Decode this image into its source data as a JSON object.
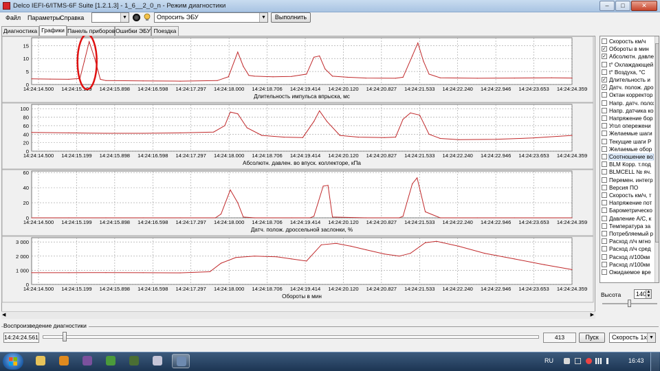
{
  "window": {
    "title": "Delco IEFI-6/ITMS-6F Suite [1.2.1.3] - 1_6__2_0_n - Режим диагностики",
    "minimize_glyph": "–",
    "maximize_glyph": "□",
    "close_glyph": "✕"
  },
  "menu": [
    "Файл",
    "Параметры",
    "Справка"
  ],
  "toolbar": {
    "port_value": "",
    "query_label": "Опросить ЭБУ",
    "execute_label": "Выполнить"
  },
  "tabs": [
    "Диагностика",
    "Графики",
    "Панель приборов",
    "Ошибки ЭБУ",
    "Поездка"
  ],
  "active_tab": "Графики",
  "colors": {
    "trace": "#c0282a",
    "grid": "#9a9a9a",
    "annotation": "#e01010"
  },
  "chart_data": [
    {
      "type": "line",
      "xlabel": "Длительность импульса впрыска, мс",
      "x_ticks": [
        "14:24:14.500",
        "14:24:15.199",
        "14:24:15.898",
        "14:24:16.598",
        "14:24:17.297",
        "14:24:18.000",
        "14:24:18.706",
        "14:24:19.414",
        "14:24:20.120",
        "14:24:20.827",
        "14:24:21.533",
        "14:24:22.240",
        "14:24:22.946",
        "14:24:23.653",
        "14:24:24.359"
      ],
      "y_ticks": [
        "0",
        "5",
        "10",
        "15"
      ],
      "ylim": [
        0,
        18
      ],
      "x": [
        0,
        0.5,
        1.0,
        1.3,
        1.42,
        1.55,
        1.7,
        1.85,
        2.0,
        3.0,
        4.0,
        5.0,
        5.3,
        5.55,
        5.7,
        5.85,
        6.0,
        6.5,
        7.0,
        7.4,
        7.6,
        7.75,
        7.9,
        8.1,
        8.5,
        9.0,
        9.8,
        10.0,
        10.25,
        10.4,
        10.55,
        10.7,
        11.0,
        12.0,
        13.0,
        14.0,
        14.55
      ],
      "values": [
        2.2,
        2.1,
        2.0,
        2.3,
        9.0,
        16.5,
        10.0,
        2.0,
        1.5,
        1.4,
        1.3,
        1.5,
        3.0,
        12.5,
        7.0,
        3.5,
        3.2,
        3.0,
        3.1,
        4.0,
        10.5,
        11.0,
        6.0,
        3.2,
        2.8,
        2.5,
        2.4,
        2.8,
        11.0,
        16.0,
        9.0,
        4.0,
        2.6,
        2.4,
        2.5,
        2.6,
        2.5
      ],
      "annotation": {
        "type": "circle",
        "around_x": 1.55
      }
    },
    {
      "type": "line",
      "xlabel": "Абсолютн. давлен. во впуск. коллекторе, кПа",
      "x_ticks": [
        "14:24:14.500",
        "14:24:15.199",
        "14:24:15.898",
        "14:24:16.598",
        "14:24:17.297",
        "14:24:18.000",
        "14:24:18.706",
        "14:24:19.414",
        "14:24:20.120",
        "14:24:20.827",
        "14:24:21.533",
        "14:24:22.240",
        "14:24:22.946",
        "14:24:23.653",
        "14:24:24.359"
      ],
      "y_ticks": [
        "0",
        "20",
        "40",
        "60",
        "80",
        "100"
      ],
      "ylim": [
        0,
        110
      ],
      "x": [
        0,
        1.0,
        2.0,
        3.0,
        4.0,
        4.9,
        5.2,
        5.35,
        5.55,
        5.8,
        6.2,
        6.8,
        7.3,
        7.6,
        7.75,
        7.95,
        8.3,
        8.8,
        9.5,
        9.8,
        10.0,
        10.2,
        10.45,
        10.7,
        11.0,
        11.5,
        12.5,
        13.5,
        14.55
      ],
      "values": [
        44,
        43,
        42,
        42,
        43,
        45,
        60,
        92,
        88,
        55,
        37,
        33,
        32,
        70,
        95,
        70,
        37,
        33,
        32,
        33,
        75,
        90,
        85,
        40,
        30,
        27,
        28,
        31,
        37
      ]
    },
    {
      "type": "line",
      "xlabel": "Датч. полож. дроссельной заслонки, %",
      "x_ticks": [
        "14:24:14.500",
        "14:24:15.199",
        "14:24:15.898",
        "14:24:16.598",
        "14:24:17.297",
        "14:24:18.000",
        "14:24:18.706",
        "14:24:19.414",
        "14:24:20.120",
        "14:24:20.827",
        "14:24:21.533",
        "14:24:22.240",
        "14:24:22.946",
        "14:24:23.653",
        "14:24:24.359"
      ],
      "y_ticks": [
        "0",
        "20",
        "40",
        "60"
      ],
      "ylim": [
        0,
        62
      ],
      "x": [
        0,
        1,
        2,
        3,
        4,
        4.95,
        5.1,
        5.35,
        5.55,
        5.7,
        6,
        7,
        7.5,
        7.6,
        7.85,
        7.98,
        8.1,
        9,
        9.9,
        10.0,
        10.25,
        10.38,
        10.6,
        11,
        12,
        13,
        14.55
      ],
      "values": [
        0,
        0,
        0,
        0,
        0,
        0,
        5,
        37,
        20,
        1,
        0,
        0,
        0,
        2,
        42,
        43,
        1,
        0,
        0,
        2,
        45,
        53,
        8,
        0,
        0,
        0,
        0
      ]
    },
    {
      "type": "line",
      "xlabel": "Обороты в мин",
      "x_ticks": [
        "14:24:14.500",
        "14:24:15.199",
        "14:24:15.898",
        "14:24:16.598",
        "14:24:17.297",
        "14:24:18.000",
        "14:24:18.706",
        "14:24:19.414",
        "14:24:20.120",
        "14:24:20.827",
        "14:24:21.533",
        "14:24:22.240",
        "14:24:22.946",
        "14:24:23.653",
        "14:24:24.359"
      ],
      "y_ticks": [
        "0",
        "1 000",
        "2 000",
        "3 000"
      ],
      "ylim": [
        0,
        3300
      ],
      "x": [
        0,
        1,
        2,
        3,
        4,
        4.8,
        5.1,
        5.5,
        6.0,
        6.6,
        7.0,
        7.4,
        7.8,
        8.2,
        8.6,
        9.0,
        9.5,
        9.9,
        10.2,
        10.6,
        10.9,
        11.5,
        12.2,
        13.0,
        13.8,
        14.55
      ],
      "values": [
        830,
        830,
        840,
        830,
        820,
        900,
        1500,
        1900,
        2000,
        1950,
        1800,
        1650,
        2800,
        2900,
        2700,
        2450,
        2150,
        2000,
        2200,
        2950,
        3050,
        2700,
        2200,
        1800,
        1400,
        1050
      ]
    }
  ],
  "params": [
    {
      "label": "Скорость км/ч",
      "checked": false
    },
    {
      "label": "Обороты в мин",
      "checked": true
    },
    {
      "label": "Абсолютн. давлен.",
      "checked": true
    },
    {
      "label": "t° Охлаждающей",
      "checked": false
    },
    {
      "label": "t° Воздуха, °С",
      "checked": false
    },
    {
      "label": "Длительность и",
      "checked": true
    },
    {
      "label": "Датч. полож. дро",
      "checked": true
    },
    {
      "label": "Октан корректор",
      "checked": false
    },
    {
      "label": "Напр. датч. полож",
      "checked": false
    },
    {
      "label": "Напр. датчика ко",
      "checked": false
    },
    {
      "label": "Напряжение бор",
      "checked": false
    },
    {
      "label": "Угол опережени",
      "checked": false
    },
    {
      "label": "Желаемые шаги",
      "checked": false
    },
    {
      "label": "Текущие шаги Р",
      "checked": false
    },
    {
      "label": "Желаемые обор",
      "checked": false
    },
    {
      "label": "Соотношение во",
      "checked": false,
      "selected": true
    },
    {
      "label": "BLM Корр. т.под",
      "checked": false
    },
    {
      "label": "BLMCELL № яч.",
      "checked": false
    },
    {
      "label": "Перемен. интегр",
      "checked": false
    },
    {
      "label": "Версия ПО",
      "checked": false
    },
    {
      "label": "Скорость км/ч, т",
      "checked": false
    },
    {
      "label": "Напряжение пот",
      "checked": false
    },
    {
      "label": "Барометрическо",
      "checked": false
    },
    {
      "label": "Давление A/C, к",
      "checked": false
    },
    {
      "label": "Температура за",
      "checked": false
    },
    {
      "label": "Потребляемый р",
      "checked": false
    },
    {
      "label": "Расход л/ч мгно",
      "checked": false
    },
    {
      "label": "Расход л/ч сред",
      "checked": false
    },
    {
      "label": "Расход л/100км",
      "checked": false
    },
    {
      "label": "Расход л/100км",
      "checked": false
    },
    {
      "label": "Ожидаемое вре",
      "checked": false
    }
  ],
  "height": {
    "label": "Высота",
    "value": "140"
  },
  "playback": {
    "label": "Воспроизведение диагностики",
    "time": "14:24:24.561",
    "count": "413",
    "start_label": "Пуск",
    "speed_label": "Скорость 1х",
    "position_fraction": 0.045
  },
  "taskbar": {
    "lang": "RU",
    "clock": "16:43",
    "apps": [
      "explorer-icon",
      "media-player-icon",
      "viber-icon",
      "chrome-icon",
      "chart-app-icon",
      "media-center-icon",
      "delco-suite-icon"
    ]
  }
}
